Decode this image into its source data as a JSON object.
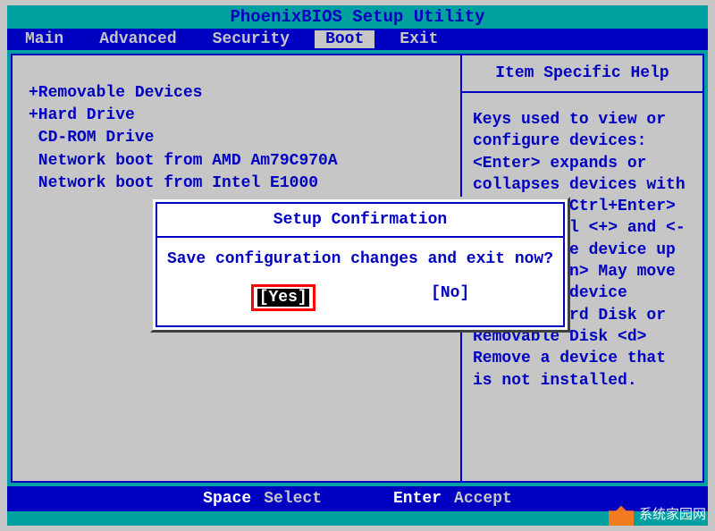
{
  "title": "PhoenixBIOS Setup Utility",
  "menu": {
    "items": [
      "Main",
      "Advanced",
      "Security",
      "Boot",
      "Exit"
    ],
    "active_index": 3
  },
  "boot_list": {
    "items": [
      "+Removable Devices",
      "+Hard Drive",
      " CD-ROM Drive",
      " Network boot from AMD Am79C970A",
      " Network boot from Intel E1000"
    ]
  },
  "help": {
    "header": "Item Specific Help",
    "body": "Keys used to view or configure devices:\n<Enter> expands or collapses devices with a + or -\n<Ctrl+Enter> expands all\n<+> and <-> moves the device up or down.\n<n> May move removable device between Hard Disk or Removable Disk\n<d> Remove a device that is not installed."
  },
  "dialog": {
    "title": "Setup Confirmation",
    "message": "Save configuration changes and exit now?",
    "yes": "[Yes]",
    "no": "[No]"
  },
  "footer": {
    "key1": "Space",
    "label1": "Select",
    "key2": "Enter",
    "label2": "Accept"
  },
  "watermark": "系统家园网"
}
